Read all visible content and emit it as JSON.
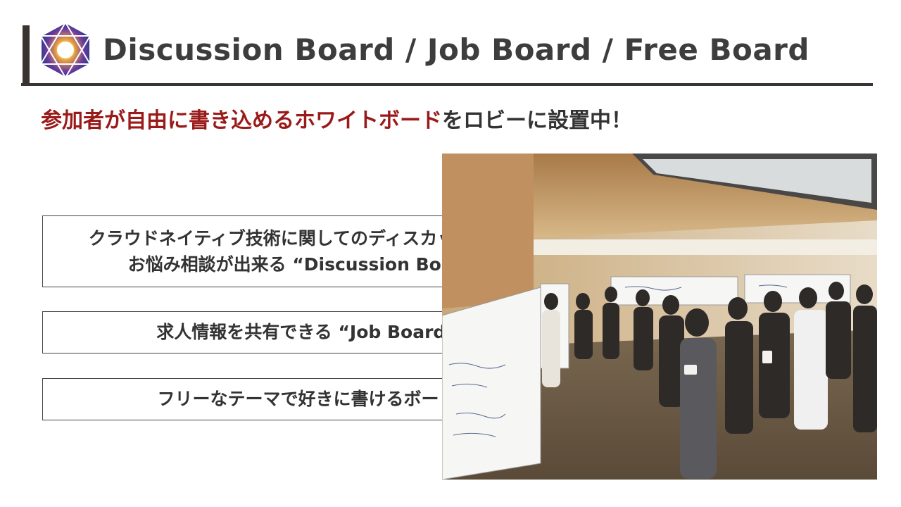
{
  "header": {
    "title": "Discussion Board / Job Board / Free Board",
    "logo_icon": "hexagon-galaxy-logo"
  },
  "subtitle": {
    "highlight": "参加者が自由に書き込めるホワイトボード",
    "rest": "をロビーに設置中！"
  },
  "boards": [
    {
      "line1": "クラウドネイティブ技術に関してのディスカッションや",
      "line2": "お悩み相談が出来る “Discussion Board”"
    },
    {
      "line1": "求人情報を共有できる “Job Board”"
    },
    {
      "line1": "フリーなテーマで好きに書けるボード"
    }
  ],
  "colors": {
    "accent_red": "#9a1a1a",
    "text_dark": "#333333",
    "rule": "#3a3330"
  }
}
